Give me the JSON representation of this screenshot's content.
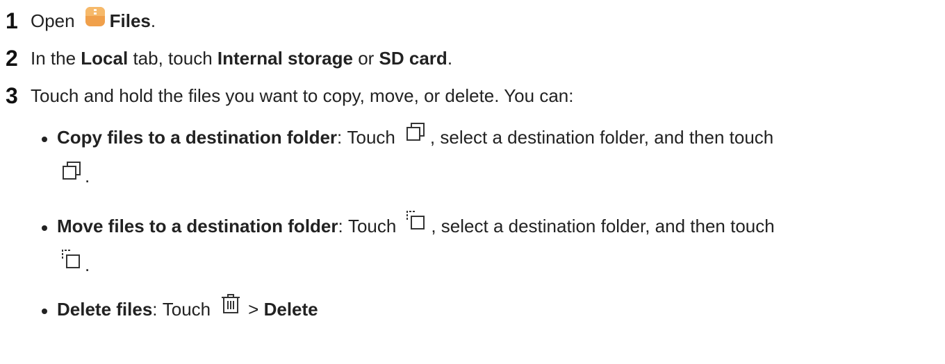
{
  "steps": [
    {
      "num": "1",
      "open": "Open",
      "app": "Files",
      "end": "."
    },
    {
      "num": "2",
      "pre": "In the",
      "tab": "Local",
      "mid": "tab, touch",
      "option1": "Internal storage",
      "or": "or",
      "option2": "SD card",
      "end": "."
    },
    {
      "num": "3",
      "text": "Touch and hold the files you want to copy, move, or delete. You can:"
    }
  ],
  "bullets": [
    {
      "title": "Copy files to a destination folder",
      "colon": ":",
      "touch": "Touch",
      "rest": ", select a destination folder, and then touch",
      "end": ".",
      "icon": "copy-icon"
    },
    {
      "title": "Move files to a destination folder",
      "colon": ":",
      "touch": "Touch",
      "rest": ", select a destination folder, and then touch",
      "end": ".",
      "icon": "move-icon"
    },
    {
      "title": "Delete files",
      "colon": ":",
      "touch": "Touch",
      "sep": ">",
      "action": "Delete",
      "icon": "trash-icon"
    }
  ],
  "colors": {
    "files_icon": "#F0A04B",
    "text": "#222222"
  }
}
